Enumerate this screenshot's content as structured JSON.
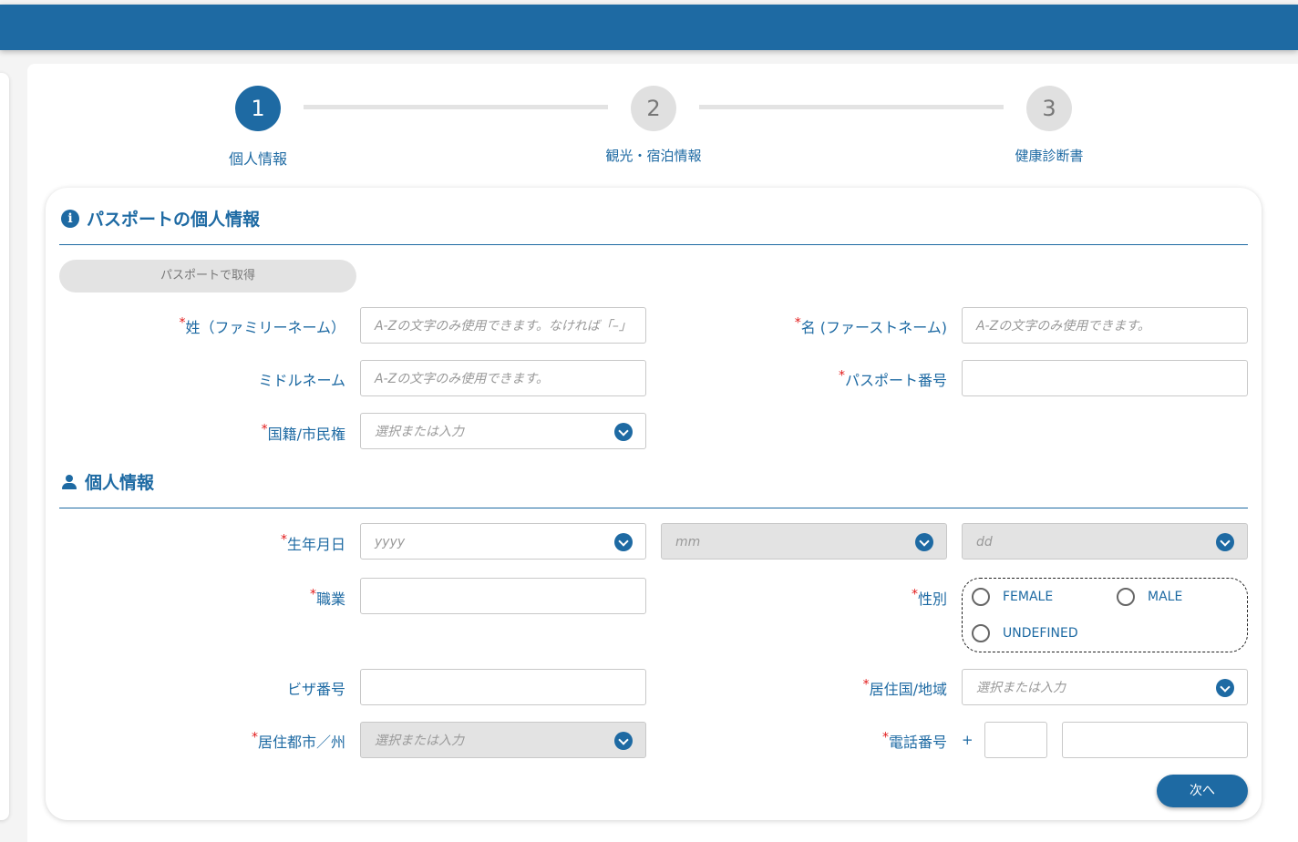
{
  "stepper": {
    "steps": [
      {
        "number": "1",
        "label": "個人情報",
        "state": "active"
      },
      {
        "number": "2",
        "label": "観光・宿泊情報",
        "state": "inactive"
      },
      {
        "number": "3",
        "label": "健康診断書",
        "state": "inactive"
      }
    ]
  },
  "passport_section": {
    "title": "パスポートの個人情報",
    "icon": "info-icon",
    "get_from_passport_button": "パスポートで取得",
    "fields": {
      "surname": {
        "label": "姓（ファミリーネーム）",
        "required": true,
        "value": "",
        "placeholder": "A-Zの文字のみ使用できます。なければ「–」"
      },
      "given_name": {
        "label": "名 (ファーストネーム)",
        "required": true,
        "value": "",
        "placeholder": "A-Zの文字のみ使用できます。"
      },
      "middle_name": {
        "label": "ミドルネーム",
        "required": false,
        "value": "",
        "placeholder": "A-Zの文字のみ使用できます。"
      },
      "passport_number": {
        "label": "パスポート番号",
        "required": true,
        "value": "",
        "placeholder": ""
      },
      "nationality": {
        "label": "国籍/市民権",
        "required": true,
        "value": "",
        "placeholder": "選択または入力"
      }
    }
  },
  "personal_section": {
    "title": "個人情報",
    "icon": "person-icon",
    "fields": {
      "birthdate": {
        "label": "生年月日",
        "required": true,
        "year_placeholder": "yyyy",
        "month_placeholder": "mm",
        "day_placeholder": "dd"
      },
      "occupation": {
        "label": "職業",
        "required": true,
        "value": ""
      },
      "gender": {
        "label": "性別",
        "required": true,
        "options": [
          "FEMALE",
          "MALE",
          "UNDEFINED"
        ],
        "selected": null
      },
      "visa_number": {
        "label": "ビザ番号",
        "required": false,
        "value": ""
      },
      "residence_country": {
        "label": "居住国/地域",
        "required": true,
        "placeholder": "選択または入力"
      },
      "residence_city": {
        "label": "居住都市／州",
        "required": true,
        "placeholder": "選択または入力"
      },
      "phone": {
        "label": "電話番号",
        "required": true,
        "prefix": "+",
        "country_code": "",
        "number": ""
      }
    }
  },
  "actions": {
    "next_button": "次へ"
  },
  "colors": {
    "primary": "#1e6aa3",
    "required": "#e21b1b",
    "disabled": "#e3e3e3"
  }
}
